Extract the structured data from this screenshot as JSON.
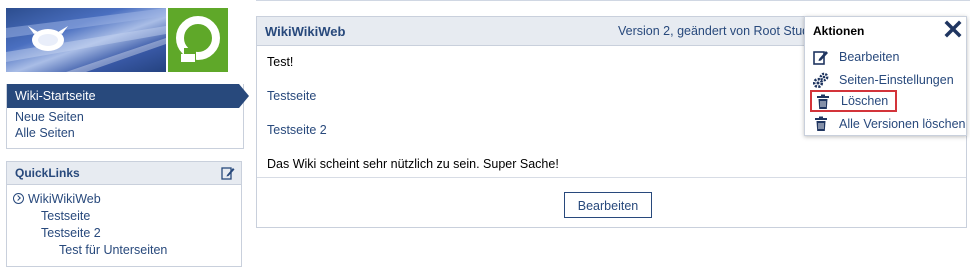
{
  "sidebar": {
    "nav": {
      "active": "Wiki-Startseite",
      "items": [
        "Neue Seiten",
        "Alle Seiten"
      ]
    },
    "quicklinks": {
      "title": "QuickLinks",
      "root": "WikiWikiWeb",
      "items": [
        "Testseite",
        "Testseite 2"
      ],
      "subitems": [
        "Test für Unterseiten"
      ]
    }
  },
  "main": {
    "title": "WikiWikiWeb",
    "version_label": "Version 2",
    "version_changed_by": ", geändert von ",
    "version_author": "Root Stud",
    "content": {
      "line1": "Test!",
      "link1": "Testseite",
      "link2": "Testseite 2",
      "text": "Das Wiki scheint sehr nützlich zu sein. Super Sache!"
    },
    "edit_button": "Bearbeiten"
  },
  "actions": {
    "title": "Aktionen",
    "items": [
      {
        "label": "Bearbeiten",
        "icon": "edit-icon"
      },
      {
        "label": "Seiten-Einstellungen",
        "icon": "gears-icon"
      },
      {
        "label": "Löschen",
        "icon": "trash-icon"
      },
      {
        "label": "Alle Versionen löschen",
        "icon": "trash-icon"
      }
    ]
  },
  "colors": {
    "brand_blue": "#28497c",
    "header_bg": "#e7ebf1",
    "logo_green": "#5fa829",
    "highlight_red": "#d3343a"
  }
}
